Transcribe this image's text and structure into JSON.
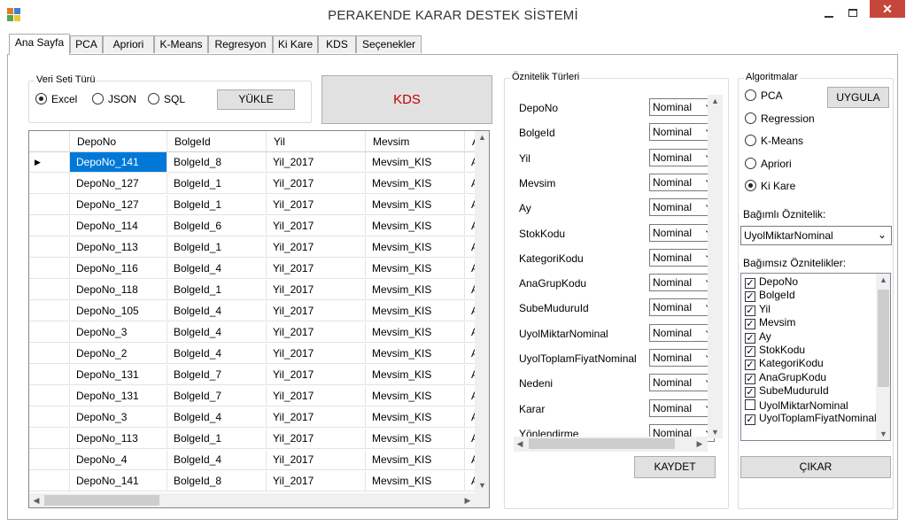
{
  "window": {
    "title": "PERAKENDE KARAR DESTEK SİSTEMİ",
    "close_symbol": "✕"
  },
  "tabs": [
    "Ana Sayfa",
    "PCA",
    "Apriori",
    "K-Means",
    "Regresyon",
    "Ki Kare",
    "KDS",
    "Seçenekler"
  ],
  "dataset": {
    "group_title": "Veri Seti Türü",
    "options": [
      "Excel",
      "JSON",
      "SQL"
    ],
    "selected": "Excel",
    "load_button": "YÜKLE",
    "kds_button": "KDS",
    "kds_color": "#c00000"
  },
  "grid": {
    "columns": [
      "DepoNo",
      "BolgeId",
      "Yil",
      "Mevsim",
      "A"
    ],
    "rows": [
      [
        "DepoNo_141",
        "BolgeId_8",
        "Yil_2017",
        "Mevsim_KIS",
        "Ay"
      ],
      [
        "DepoNo_127",
        "BolgeId_1",
        "Yil_2017",
        "Mevsim_KIS",
        "Ay"
      ],
      [
        "DepoNo_127",
        "BolgeId_1",
        "Yil_2017",
        "Mevsim_KIS",
        "Ay"
      ],
      [
        "DepoNo_114",
        "BolgeId_6",
        "Yil_2017",
        "Mevsim_KIS",
        "Ay"
      ],
      [
        "DepoNo_113",
        "BolgeId_1",
        "Yil_2017",
        "Mevsim_KIS",
        "Ay"
      ],
      [
        "DepoNo_116",
        "BolgeId_4",
        "Yil_2017",
        "Mevsim_KIS",
        "Ay"
      ],
      [
        "DepoNo_118",
        "BolgeId_1",
        "Yil_2017",
        "Mevsim_KIS",
        "Ay"
      ],
      [
        "DepoNo_105",
        "BolgeId_4",
        "Yil_2017",
        "Mevsim_KIS",
        "Ay"
      ],
      [
        "DepoNo_3",
        "BolgeId_4",
        "Yil_2017",
        "Mevsim_KIS",
        "Ay"
      ],
      [
        "DepoNo_2",
        "BolgeId_4",
        "Yil_2017",
        "Mevsim_KIS",
        "Ay"
      ],
      [
        "DepoNo_131",
        "BolgeId_7",
        "Yil_2017",
        "Mevsim_KIS",
        "Ay"
      ],
      [
        "DepoNo_131",
        "BolgeId_7",
        "Yil_2017",
        "Mevsim_KIS",
        "Ay"
      ],
      [
        "DepoNo_3",
        "BolgeId_4",
        "Yil_2017",
        "Mevsim_KIS",
        "Ay"
      ],
      [
        "DepoNo_113",
        "BolgeId_1",
        "Yil_2017",
        "Mevsim_KIS",
        "Ay"
      ],
      [
        "DepoNo_4",
        "BolgeId_4",
        "Yil_2017",
        "Mevsim_KIS",
        "Ay"
      ],
      [
        "DepoNo_141",
        "BolgeId_8",
        "Yil_2017",
        "Mevsim_KIS",
        "Ay"
      ]
    ],
    "current_row_marker": "▶"
  },
  "attributes": {
    "group_title": "Öznitelik Türleri",
    "items": [
      {
        "name": "DepoNo",
        "type": "Nominal"
      },
      {
        "name": "BolgeId",
        "type": "Nominal"
      },
      {
        "name": "Yil",
        "type": "Nominal"
      },
      {
        "name": "Mevsim",
        "type": "Nominal"
      },
      {
        "name": "Ay",
        "type": "Nominal"
      },
      {
        "name": "StokKodu",
        "type": "Nominal"
      },
      {
        "name": "KategoriKodu",
        "type": "Nominal"
      },
      {
        "name": "AnaGrupKodu",
        "type": "Nominal"
      },
      {
        "name": "SubeMuduruId",
        "type": "Nominal"
      },
      {
        "name": "UyolMiktarNominal",
        "type": "Nominal"
      },
      {
        "name": "UyolToplamFiyatNominal",
        "type": "Nominal"
      },
      {
        "name": "Nedeni",
        "type": "Nominal"
      },
      {
        "name": "Karar",
        "type": "Nominal"
      },
      {
        "name": "Yönlendirme",
        "type": "Nominal"
      }
    ],
    "save_button": "KAYDET"
  },
  "algorithms": {
    "group_title": "Algoritmalar",
    "options": [
      "PCA",
      "Regression",
      "K-Means",
      "Apriori",
      "Ki Kare"
    ],
    "selected": "Ki Kare",
    "apply_button": "UYGULA",
    "dependent_label": "Bağımlı Öznitelik:",
    "dependent_value": "UyolMiktarNominal",
    "independent_label": "Bağımsız Öznitelikler:",
    "independent_items": [
      {
        "name": "DepoNo",
        "checked": true
      },
      {
        "name": "BolgeId",
        "checked": true
      },
      {
        "name": "Yil",
        "checked": true
      },
      {
        "name": "Mevsim",
        "checked": true
      },
      {
        "name": "Ay",
        "checked": true
      },
      {
        "name": "StokKodu",
        "checked": true
      },
      {
        "name": "KategoriKodu",
        "checked": true
      },
      {
        "name": "AnaGrupKodu",
        "checked": true
      },
      {
        "name": "SubeMuduruId",
        "checked": true
      },
      {
        "name": "UyolMiktarNominal",
        "checked": false
      },
      {
        "name": "UyolToplamFiyatNominal",
        "checked": true
      }
    ],
    "remove_button": "ÇIKAR"
  }
}
